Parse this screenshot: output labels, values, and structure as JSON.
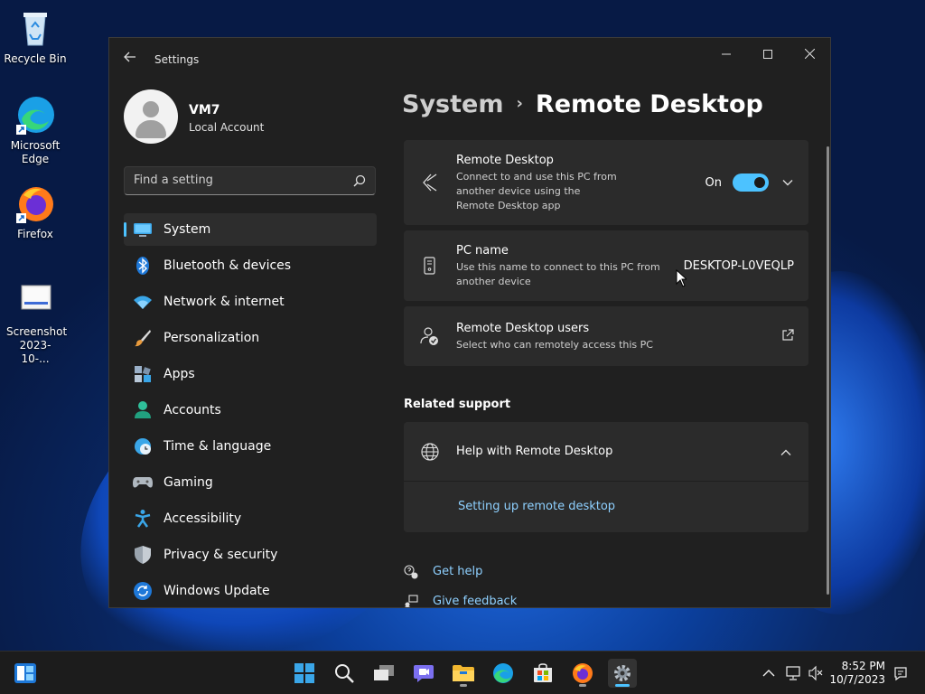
{
  "desktop": {
    "icons": [
      {
        "label": "Recycle Bin"
      },
      {
        "label": "Microsoft Edge"
      },
      {
        "label": "Firefox"
      },
      {
        "label": "Screenshot 2023-10-..."
      }
    ]
  },
  "window": {
    "title": "Settings",
    "controls": {
      "minimize": "─",
      "maximize": "☐",
      "close": "✕"
    }
  },
  "sidebar": {
    "user_name": "VM7",
    "account_type": "Local Account",
    "search_placeholder": "Find a setting",
    "items": [
      {
        "label": "System",
        "icon": "system-icon",
        "active": true
      },
      {
        "label": "Bluetooth & devices",
        "icon": "bluetooth-icon"
      },
      {
        "label": "Network & internet",
        "icon": "wifi-icon"
      },
      {
        "label": "Personalization",
        "icon": "brush-icon"
      },
      {
        "label": "Apps",
        "icon": "apps-icon"
      },
      {
        "label": "Accounts",
        "icon": "accounts-icon"
      },
      {
        "label": "Time & language",
        "icon": "clock-globe-icon"
      },
      {
        "label": "Gaming",
        "icon": "gamepad-icon"
      },
      {
        "label": "Accessibility",
        "icon": "accessibility-icon"
      },
      {
        "label": "Privacy & security",
        "icon": "shield-icon"
      },
      {
        "label": "Windows Update",
        "icon": "update-icon"
      }
    ]
  },
  "main": {
    "breadcrumb_parent": "System",
    "breadcrumb_separator": "›",
    "breadcrumb_current": "Remote Desktop",
    "remote_desktop": {
      "title": "Remote Desktop",
      "description": "Connect to and use this PC from another device using the Remote Desktop app",
      "toggle_label": "On",
      "toggle_on": true
    },
    "pc_name": {
      "title": "PC name",
      "description": "Use this name to connect to this PC from another device",
      "value": "DESKTOP-L0VEQLP"
    },
    "users": {
      "title": "Remote Desktop users",
      "description": "Select who can remotely access this PC"
    },
    "related_support": {
      "heading": "Related support",
      "help_title": "Help with Remote Desktop",
      "help_link": "Setting up remote desktop"
    },
    "get_help": "Get help",
    "give_feedback": "Give feedback"
  },
  "taskbar": {
    "time": "8:52 PM",
    "date": "10/7/2023"
  },
  "colors": {
    "accent": "#4cc2ff",
    "window_bg": "#202020",
    "card_bg": "#2b2b2b",
    "link": "#8ed0ff"
  }
}
